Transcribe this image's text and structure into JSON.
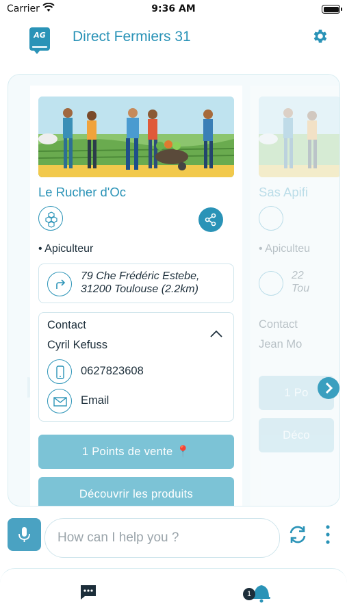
{
  "status_bar": {
    "carrier": "Carrier",
    "time": "9:36 AM"
  },
  "header": {
    "title": "Direct Fermiers 31",
    "logo_text": "AG"
  },
  "cards": [
    {
      "name": "Le Rucher d'Oc",
      "category": "• Apiculteur",
      "address_line1": "79 Che Frédéric Estebe,",
      "address_line2": "31200 Toulouse (2.2km)",
      "contact_title": "Contact",
      "contact_name": "Cyril Kefuss",
      "phone": "0627823608",
      "email_label": "Email",
      "points_button": "1 Points de vente 📍",
      "discover_button": "Découvrir les produits"
    },
    {
      "name": "Sas Apifi",
      "category": "• Apiculteu",
      "address_line1": "22",
      "address_line2": "Tou",
      "contact_title": "Contact",
      "contact_name": "Jean Mo",
      "points_button": "1 Po",
      "discover_button": "Déco"
    }
  ],
  "chat": {
    "placeholder": "How can I help you ?"
  },
  "tabbar": {
    "notification_count": "1"
  },
  "colors": {
    "accent": "#2a93b7",
    "button": "#7cc3d6",
    "text": "#1c2e3a"
  },
  "icons": [
    "wifi-icon",
    "battery-icon",
    "gear-icon",
    "hive-icon",
    "share-icon",
    "directions-icon",
    "chevron-up-icon",
    "phone-icon",
    "mail-icon",
    "chevron-right-icon",
    "microphone-icon",
    "refresh-icon",
    "more-vertical-icon",
    "chat-icon",
    "bell-icon"
  ]
}
